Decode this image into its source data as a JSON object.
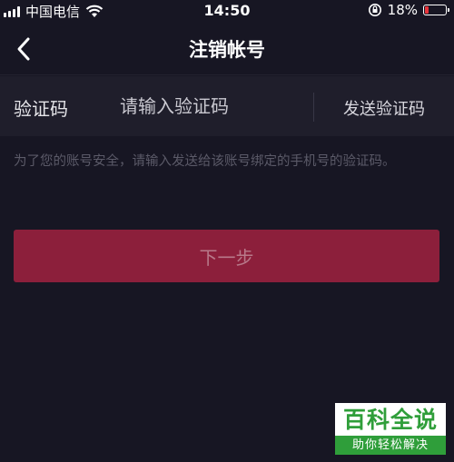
{
  "status_bar": {
    "carrier": "中国电信",
    "time": "14:50",
    "battery": "18%",
    "battery_level": 0.18,
    "icons": [
      "signal-icon",
      "wifi-icon",
      "rotation-lock-icon",
      "battery-icon"
    ]
  },
  "nav": {
    "title": "注销帐号",
    "back_icon": "chevron-left-icon"
  },
  "verification": {
    "label": "验证码",
    "placeholder": "请输入验证码",
    "value": "",
    "send_label": "发送验证码"
  },
  "hint": "为了您的账号安全，请输入发送给该账号绑定的手机号的验证码。",
  "next_button": "下一步",
  "watermark": {
    "title": "百科全说",
    "subtitle": "助你轻松解决"
  },
  "colors": {
    "background": "#171623",
    "row_background": "#1f1e2b",
    "primary_button": "#8c1f3b",
    "battery_low": "#e8333a",
    "watermark_green": "#2f9e3a"
  }
}
